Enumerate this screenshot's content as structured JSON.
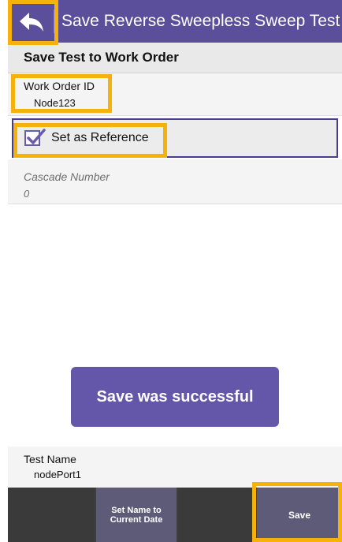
{
  "header": {
    "title": "Save Reverse Sweepless Sweep Test",
    "back_icon": "back-arrow-icon"
  },
  "section": {
    "title": "Save Test to Work Order"
  },
  "work_order": {
    "label": "Work Order ID",
    "value": "Node123"
  },
  "reference": {
    "label": "Set as Reference",
    "checked": true
  },
  "cascade": {
    "label": "Cascade Number",
    "value": "0"
  },
  "toast": {
    "message": "Save was successful"
  },
  "test_name": {
    "label": "Test Name",
    "value": "nodePort1"
  },
  "footer": {
    "date_button": "Set Name to\nCurrent Date",
    "save_button": "Save"
  },
  "colors": {
    "header": "#5b4e9a",
    "highlight": "#f5b20a",
    "button": "#5e5b79",
    "toast": "#6457a9"
  }
}
